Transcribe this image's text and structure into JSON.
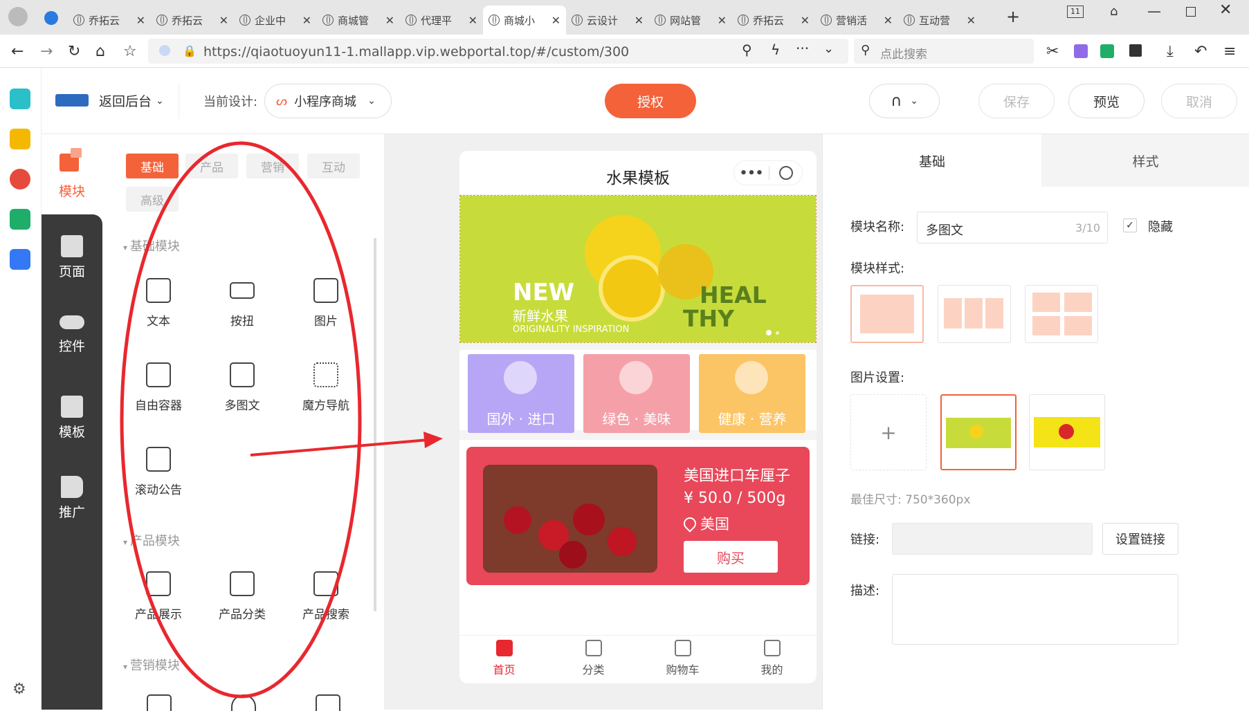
{
  "browser": {
    "tabs": [
      {
        "label": "乔拓云",
        "icon": "paw-icon",
        "active": false
      },
      {
        "label": "乔拓云",
        "icon": "n-logo-icon",
        "active": false
      },
      {
        "label": "企业中",
        "icon": "globe-icon",
        "active": false
      },
      {
        "label": "商城管",
        "icon": "globe-icon",
        "active": false
      },
      {
        "label": "代理平",
        "icon": "n-logo-icon",
        "active": false
      },
      {
        "label": "商城小",
        "icon": "globe-icon",
        "active": true
      },
      {
        "label": "云设计",
        "icon": "globe-icon",
        "active": false
      },
      {
        "label": "网站管",
        "icon": "globe-icon",
        "active": false
      },
      {
        "label": "乔拓云",
        "icon": "globe-icon",
        "active": false
      },
      {
        "label": "营销活",
        "icon": "globe-icon",
        "active": false
      },
      {
        "label": "互动营",
        "icon": "globe-icon",
        "active": false
      }
    ],
    "tab_count": "11",
    "url": "https://qiaotuoyun11-1.mallapp.vip.webportal.top/#/custom/300",
    "search_placeholder": "点此搜索"
  },
  "header": {
    "back_label": "返回后台",
    "current_design_label": "当前设计:",
    "design_name": "小程序商城",
    "authorize_label": "授权",
    "save_label": "保存",
    "preview_label": "预览",
    "cancel_label": "取消"
  },
  "left_nav": {
    "items": [
      {
        "label": "模块",
        "icon": "module-icon",
        "active": true
      },
      {
        "label": "页面",
        "icon": "page-icon",
        "active": false
      },
      {
        "label": "控件",
        "icon": "toggle-icon",
        "active": false
      },
      {
        "label": "模板",
        "icon": "template-icon",
        "active": false
      },
      {
        "label": "推广",
        "icon": "megaphone-icon",
        "active": false
      }
    ]
  },
  "module_panel": {
    "categories": [
      {
        "label": "基础",
        "active": true
      },
      {
        "label": "产品",
        "active": false
      },
      {
        "label": "营销",
        "active": false
      },
      {
        "label": "互动",
        "active": false
      },
      {
        "label": "高级",
        "active": false
      }
    ],
    "sections": [
      {
        "title": "基础模块",
        "items": [
          {
            "label": "文本",
            "icon": "text-icon"
          },
          {
            "label": "按扭",
            "icon": "button-icon"
          },
          {
            "label": "图片",
            "icon": "image-icon"
          },
          {
            "label": "自由容器",
            "icon": "container-icon"
          },
          {
            "label": "多图文",
            "icon": "multi-image-icon"
          },
          {
            "label": "魔方导航",
            "icon": "grid-dots-icon"
          },
          {
            "label": "滚动公告",
            "icon": "notice-icon"
          }
        ]
      },
      {
        "title": "产品模块",
        "items": [
          {
            "label": "产品展示",
            "icon": "product-grid-icon"
          },
          {
            "label": "产品分类",
            "icon": "product-category-icon"
          },
          {
            "label": "产品搜索",
            "icon": "product-search-icon"
          }
        ]
      },
      {
        "title": "营销模块",
        "items": []
      }
    ]
  },
  "phone": {
    "title": "水果模板",
    "banner": {
      "new_text": "NEW",
      "cn_text": "新鲜水果",
      "sub_text": "ORIGINALITY INSPIRATION",
      "right_text_1": "HEAL",
      "right_text_2": "THY",
      "bg_color": "#c7dc3a"
    },
    "tiles": [
      {
        "label": "国外 · 进口",
        "color": "#b7a6f5",
        "icon": "watermelon-icon"
      },
      {
        "label": "绿色 · 美味",
        "color": "#f5a0a8",
        "icon": "pineapple-icon"
      },
      {
        "label": "健康 · 营养",
        "color": "#fbc465",
        "icon": "orange-icon"
      }
    ],
    "product": {
      "name": "美国进口车厘子",
      "price": "¥ 50.0 / 500g",
      "origin": "美国",
      "buy_label": "购买",
      "card_color": "#e8485a"
    },
    "tabbar": [
      {
        "label": "首页",
        "icon": "home-icon",
        "active": true
      },
      {
        "label": "分类",
        "icon": "category-icon",
        "active": false
      },
      {
        "label": "购物车",
        "icon": "cart-icon",
        "active": false
      },
      {
        "label": "我的",
        "icon": "user-icon",
        "active": false
      }
    ]
  },
  "right_panel": {
    "tabs": [
      {
        "label": "基础",
        "active": true
      },
      {
        "label": "样式",
        "active": false
      }
    ],
    "module_name_label": "模块名称:",
    "module_name_value": "多图文",
    "module_name_count": "3/10",
    "hide_label": "隐藏",
    "hide_checked": true,
    "style_label": "模块样式:",
    "image_settings_label": "图片设置:",
    "best_size": "最佳尺寸: 750*360px",
    "link_label": "链接:",
    "set_link_label": "设置链接",
    "desc_label": "描述:"
  },
  "colors": {
    "accent": "#f4623a",
    "annotation": "#e8282e",
    "dark_nav": "#3a3a3a"
  }
}
